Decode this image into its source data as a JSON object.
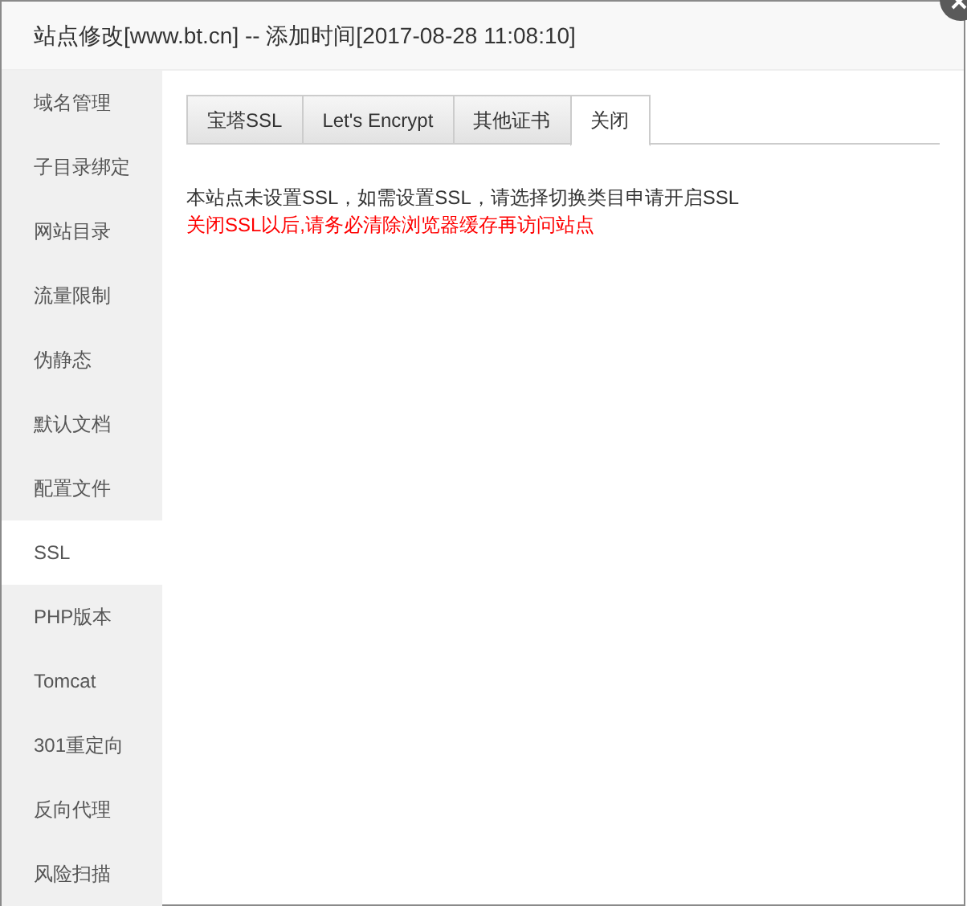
{
  "window": {
    "title": "站点修改[www.bt.cn] -- 添加时间[2017-08-28 11:08:10]"
  },
  "sidebar": {
    "items": [
      {
        "label": "域名管理",
        "selected": false
      },
      {
        "label": "子目录绑定",
        "selected": false
      },
      {
        "label": "网站目录",
        "selected": false
      },
      {
        "label": "流量限制",
        "selected": false
      },
      {
        "label": "伪静态",
        "selected": false
      },
      {
        "label": "默认文档",
        "selected": false
      },
      {
        "label": "配置文件",
        "selected": false
      },
      {
        "label": "SSL",
        "selected": true
      },
      {
        "label": "PHP版本",
        "selected": false
      },
      {
        "label": "Tomcat",
        "selected": false
      },
      {
        "label": "301重定向",
        "selected": false
      },
      {
        "label": "反向代理",
        "selected": false
      },
      {
        "label": "风险扫描",
        "selected": false
      }
    ]
  },
  "tabs": [
    {
      "label": "宝塔SSL",
      "selected": false
    },
    {
      "label": "Let's Encrypt",
      "selected": false
    },
    {
      "label": "其他证书",
      "selected": false
    },
    {
      "label": "关闭",
      "selected": true
    }
  ],
  "content": {
    "notice": "本站点未设置SSL，如需设置SSL，请选择切换类目申请开启SSL",
    "warning": "关闭SSL以后,请务必清除浏览器缓存再访问站点"
  }
}
